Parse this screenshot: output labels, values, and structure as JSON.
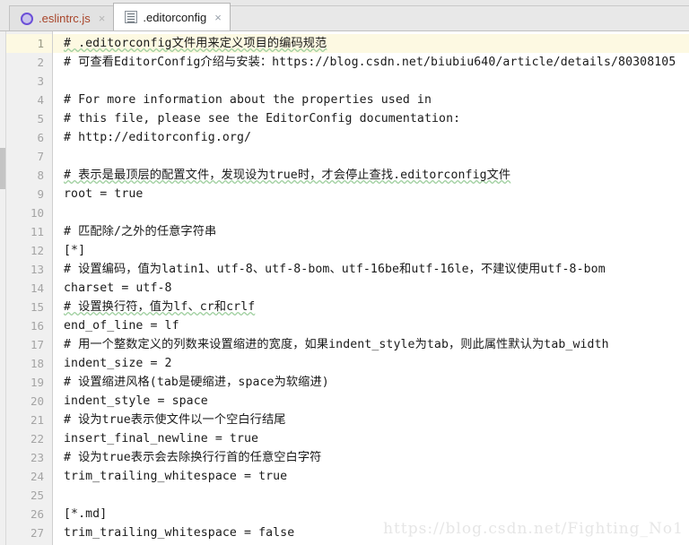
{
  "window": {
    "title": ".editorconfig",
    "colors": {
      "tab_bar_bg": "#e8e8e8",
      "active_tab_bg": "#ffffff",
      "inactive_tab_fg": "#a8452a",
      "gutter_bg": "#f0f0f0",
      "current_line_bg": "#fdf9e2",
      "code_fg": "#1a1a1a",
      "lineno_fg": "#a4a4a4",
      "watermark_fg": "#e6e6e6"
    }
  },
  "tabs": [
    {
      "label": ".eslintrc.js",
      "icon": "eslint-circle-icon",
      "close_glyph": "×",
      "active": false
    },
    {
      "label": ".editorconfig",
      "icon": "text-file-icon",
      "close_glyph": "×",
      "active": true
    }
  ],
  "editor": {
    "current_line": 1,
    "line_numbers": [
      "1",
      "2",
      "3",
      "4",
      "5",
      "6",
      "7",
      "8",
      "9",
      "10",
      "11",
      "12",
      "13",
      "14",
      "15",
      "16",
      "17",
      "18",
      "19",
      "20",
      "21",
      "22",
      "23",
      "24",
      "25",
      "26",
      "27"
    ],
    "lines": [
      "# .editorconfig文件用来定义项目的编码规范",
      "# 可查看EditorConfig介绍与安装：https://blog.csdn.net/biubiu640/article/details/80308105",
      "",
      "# For more information about the properties used in",
      "# this file, please see the EditorConfig documentation:",
      "# http://editorconfig.org/",
      "",
      "# 表示是最顶层的配置文件，发现设为true时，才会停止查找.editorconfig文件",
      "root = true",
      "",
      "# 匹配除/之外的任意字符串",
      "[*]",
      "# 设置编码，值为latin1、utf-8、utf-8-bom、utf-16be和utf-16le，不建议使用utf-8-bom",
      "charset = utf-8",
      "# 设置换行符，值为lf、cr和crlf",
      "end_of_line = lf",
      "# 用一个整数定义的列数来设置缩进的宽度，如果indent_style为tab，则此属性默认为tab_width",
      "indent_size = 2",
      "# 设置缩进风格(tab是硬缩进，space为软缩进)",
      "indent_style = space",
      "# 设为true表示使文件以一个空白行结尾",
      "insert_final_newline = true",
      "# 设为true表示会去除换行行首的任意空白字符",
      "trim_trailing_whitespace = true",
      "",
      "[*.md]",
      "trim_trailing_whitespace = false"
    ],
    "spellcheck_lines": [
      1,
      8,
      15
    ]
  },
  "watermark": {
    "text": "https://blog.csdn.net/Fighting_No1"
  }
}
